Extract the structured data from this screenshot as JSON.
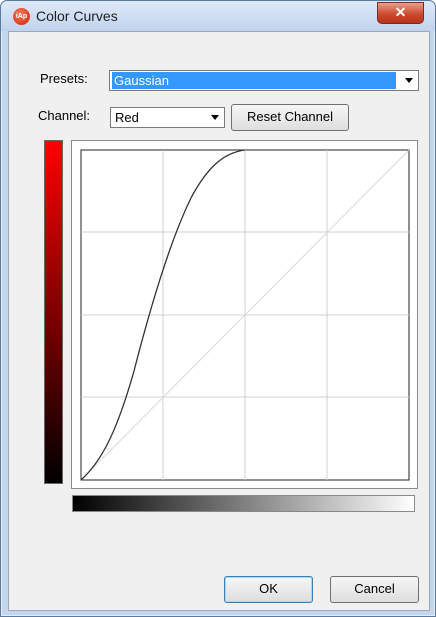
{
  "window": {
    "title": "Color Curves",
    "icon_text": "iAp",
    "close_glyph": "✕"
  },
  "presets": {
    "label": "Presets:",
    "value": "Gaussian"
  },
  "channel": {
    "label": "Channel:",
    "value": "Red"
  },
  "reset_button": "Reset Channel",
  "ok_button": "OK",
  "cancel_button": "Cancel",
  "colors": {
    "selection": "#3399ff",
    "channel_color": "#ff0000"
  },
  "icons": [
    "app-icon",
    "close-icon",
    "chevron-down-icon"
  ]
}
